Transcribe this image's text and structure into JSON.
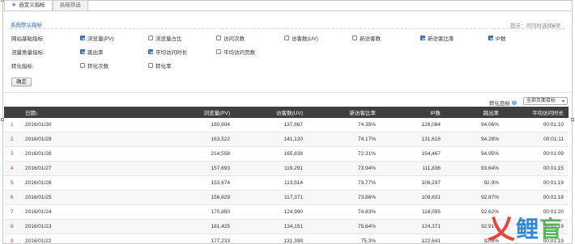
{
  "tabs": [
    {
      "label": "自定义指标",
      "icon": "star-icon",
      "active": true
    },
    {
      "label": "高级筛选",
      "active": false
    }
  ],
  "section": {
    "title": "系统默认指标",
    "hint_prefix": "提示：可同时选择",
    "hint_count": "6",
    "hint_suffix": "项"
  },
  "metric_rows": [
    {
      "label": "网站基础指标:",
      "options": [
        {
          "label": "浏览量(PV)",
          "checked": true
        },
        {
          "label": "浏览量占比",
          "checked": false
        },
        {
          "label": "访问次数",
          "checked": false
        },
        {
          "label": "访客数(UV)",
          "checked": false
        },
        {
          "label": "新访客数",
          "checked": false
        },
        {
          "label": "新访客比率",
          "checked": true
        },
        {
          "label": "IP数",
          "checked": true
        }
      ]
    },
    {
      "label": "流量质量指标:",
      "options": [
        {
          "label": "跳出率",
          "checked": true
        },
        {
          "label": "平均访问时长",
          "checked": true
        },
        {
          "label": "平均访问页数",
          "checked": false
        }
      ]
    },
    {
      "label": "转化指标:",
      "options": [
        {
          "label": "转化次数",
          "checked": false
        },
        {
          "label": "转化率",
          "checked": false
        }
      ]
    }
  ],
  "ok_button": "确定",
  "conversion": {
    "label": "转化目标",
    "selected": "全部页面目标"
  },
  "table": {
    "headers": [
      "",
      "日期↓",
      "浏览量(PV)",
      "访客数(UV)",
      "新访客比率",
      "IP数",
      "跳出率",
      "平均访问时长"
    ],
    "rows": [
      [
        "1",
        "2016/01/30",
        "180,604",
        "137,867",
        "74.35%",
        "128,084",
        "94.06%",
        "00:01:10"
      ],
      [
        "2",
        "2016/01/29",
        "163,522",
        "141,120",
        "74.17%",
        "131,618",
        "94.28%",
        "00:01:11"
      ],
      [
        "3",
        "2016/01/28",
        "214,558",
        "165,838",
        "72.31%",
        "154,467",
        "94.95%",
        "00:01:09"
      ],
      [
        "4",
        "2016/01/27",
        "157,693",
        "119,291",
        "73.94%",
        "111,836",
        "93.64%",
        "00:01:15"
      ],
      [
        "5",
        "2016/01/26",
        "153,674",
        "113,514",
        "73.77%",
        "106,297",
        "92.9%",
        "00:01:19"
      ],
      [
        "6",
        "2016/01/25",
        "156,829",
        "117,371",
        "73.86%",
        "109,631",
        "92.87%",
        "00:01:18"
      ],
      [
        "7",
        "2016/01/24",
        "170,850",
        "124,990",
        "74.83%",
        "116,055",
        "92.62%",
        "00:01:20"
      ],
      [
        "8",
        "2016/01/23",
        "181,425",
        "134,151",
        "75.64%",
        "124,371",
        "92.91%",
        "00:01:19"
      ],
      [
        "9",
        "2016/01/22",
        "177,233",
        "131,399",
        "75.3%",
        "122,641",
        "92.8%",
        "00:01:19"
      ]
    ]
  },
  "watermark": {
    "chars": [
      "乂",
      "鲤",
      "盲"
    ]
  }
}
